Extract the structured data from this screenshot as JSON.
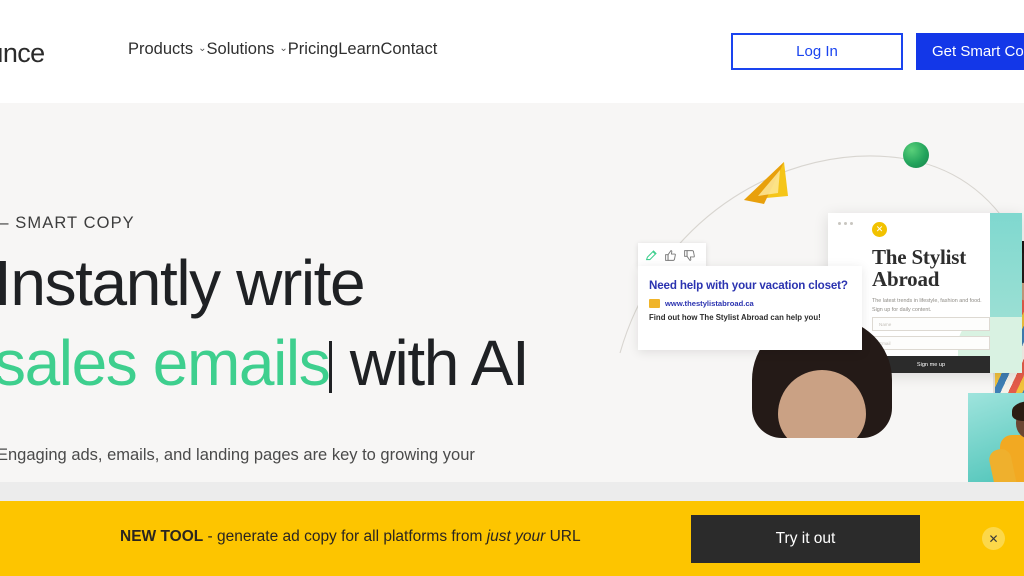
{
  "header": {
    "logo_text": "ounce",
    "nav": [
      {
        "label": "Products",
        "has_chevron": true,
        "chevron": "⌄"
      },
      {
        "label": "Solutions",
        "has_chevron": true,
        "chevron": "⌄"
      },
      {
        "label": "Pricing",
        "has_chevron": false,
        "chevron": ""
      },
      {
        "label": "Learn",
        "has_chevron": false,
        "chevron": ""
      },
      {
        "label": "Contact",
        "has_chevron": false,
        "chevron": ""
      }
    ],
    "login_label": "Log In",
    "cta_label": "Get Smart Copy",
    "accent_blue": "#1337e8",
    "background": "#ffffff"
  },
  "hero": {
    "eyebrow": "— SMART COPY",
    "headline_line1": "Instantly write",
    "headline_green": "sales emails",
    "headline_rest": " with AI",
    "subheading": "Engaging ads, emails, and landing pages are key to growing your",
    "background": "#f7f6f5",
    "green": "#3ecf8e",
    "text_color": "#1f2124"
  },
  "illustration": {
    "ad_card": {
      "title": "Need help with your vacation closet?",
      "url": "www.thestylistabroad.ca",
      "description": "Find out how The Stylist Abroad can help you!",
      "toolbar_icons": [
        "pencil-icon",
        "thumbs-up-icon",
        "thumbs-down-icon"
      ]
    },
    "landing_page_card": {
      "heading": "The Stylist Abroad",
      "body": "The latest trends in lifestyle, fashion and food. Sign up for daily content.",
      "input_1_placeholder": "Name",
      "input_2_placeholder": "Email",
      "button_label": "Sign me up",
      "logo_glyph": "✕"
    },
    "shapes": {
      "cone_color": "#f0ad0e",
      "sphere_color": "#23a45c",
      "robot_screen_color": "#3ecf8e",
      "sparkle": "✦"
    }
  },
  "banner": {
    "badge": "NEW TOOL",
    "text_before": " - generate ad copy for all platforms from ",
    "text_italic": "just your",
    "text_after": " URL",
    "button_label": "Try it out",
    "close_glyph": "✕",
    "background": "#fdc500",
    "button_background": "#2b2b2b"
  }
}
